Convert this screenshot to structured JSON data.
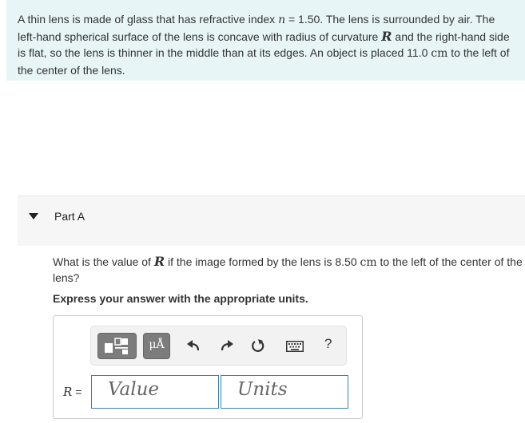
{
  "problem": {
    "seg1": "A thin lens is made of glass that has refractive index ",
    "var_n": "n",
    "seg2": " = 1.50. The lens is surrounded by air. The left-hand spherical surface of the lens is concave with radius of curvature ",
    "var_R": "R",
    "seg3": " and the right-hand side is flat, so the lens is thinner in the middle than at its edges. An object is placed 11.0 ",
    "unit_cm": "cm",
    "seg4": " to the left of the center of the lens."
  },
  "part": {
    "title": "Part A"
  },
  "question": {
    "seg1": "What is the value of ",
    "var_R": "R",
    "seg2": " if the image formed by the lens is 8.50 ",
    "unit_cm": "cm",
    "seg3": " to the left of the center of the lens?",
    "instruction": "Express your answer with the appropriate units."
  },
  "toolbar": {
    "units_symbol": "μÅ",
    "help": "?"
  },
  "answer": {
    "var": "R",
    "eq": " =",
    "value_placeholder": "Value",
    "units_placeholder": "Units"
  }
}
